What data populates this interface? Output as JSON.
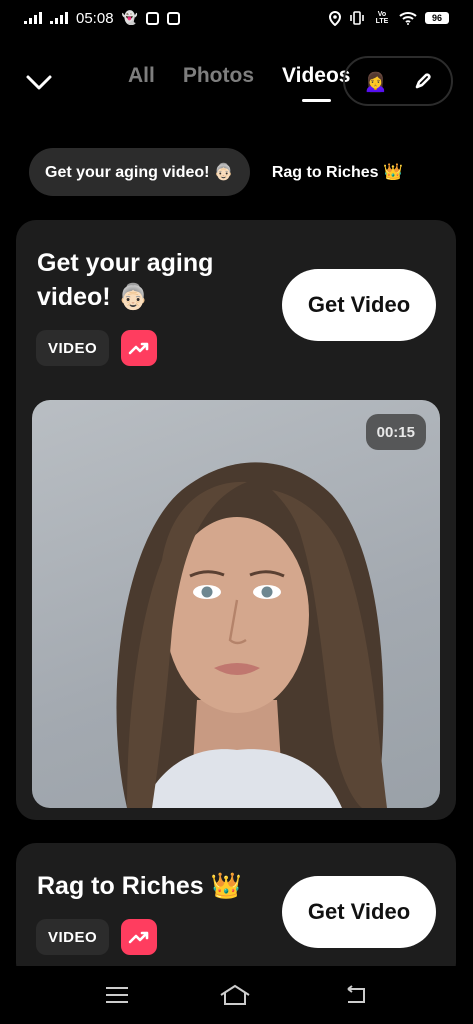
{
  "status_bar": {
    "time": "05:08",
    "battery": "96",
    "lte": "Vo LTE"
  },
  "nav": {
    "tabs": [
      {
        "label": "All"
      },
      {
        "label": "Photos"
      },
      {
        "label": "Videos"
      }
    ],
    "active_tab": "Videos",
    "avatar_emoji": "🙍‍♀️"
  },
  "chips": [
    {
      "label": "Get your aging video! 👵🏻"
    },
    {
      "label": "Rag to Riches 👑"
    }
  ],
  "cards": [
    {
      "title": "Get your aging video! 👵🏻",
      "tag": "VIDEO",
      "button": "Get Video",
      "duration": "00:15"
    },
    {
      "title": "Rag to Riches 👑",
      "tag": "VIDEO",
      "button": "Get Video"
    }
  ],
  "colors": {
    "background": "#000000",
    "card": "#1d1d1d",
    "trend_badge": "#ff3d5f"
  }
}
